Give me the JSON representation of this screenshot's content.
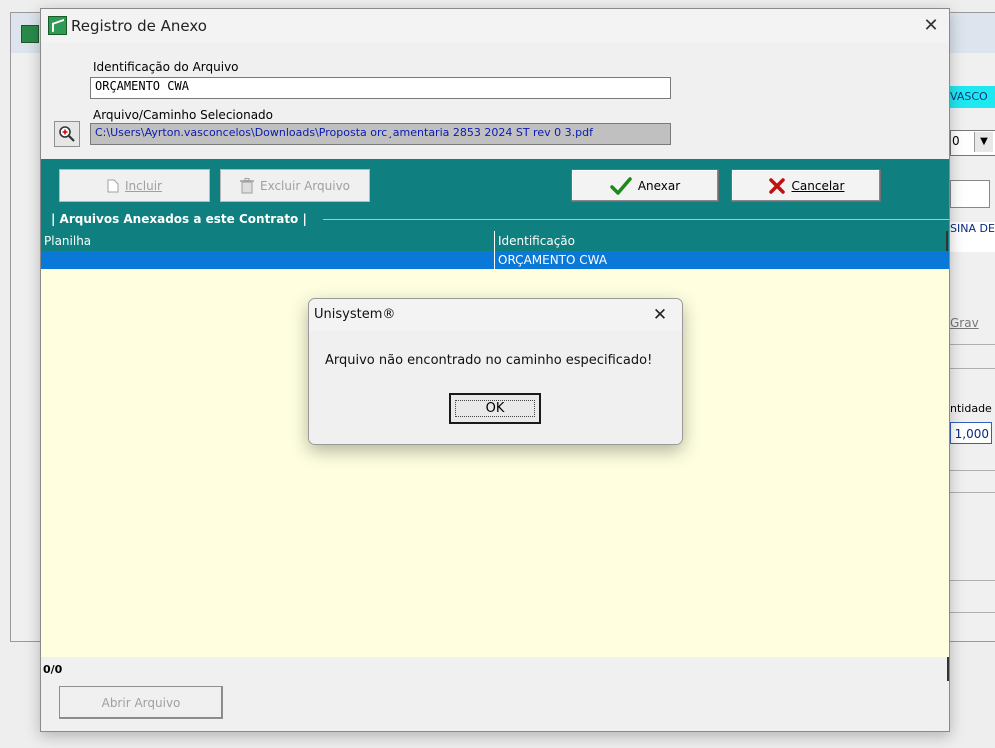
{
  "background_window": {
    "cyan_text": "VASCO",
    "combo_value": "0",
    "combo_arrow": "▼",
    "teal_label": "SINA DE",
    "grav_label": "Grav",
    "qty_header": "ntidade",
    "qty_value": "1,000"
  },
  "dialog": {
    "title": "Registro de Anexo",
    "close_glyph": "✕",
    "identificacao_label": "Identificação do Arquivo",
    "identificacao_value": "ORÇAMENTO CWA",
    "caminho_label": "Arquivo/Caminho Selecionado",
    "caminho_value": "C:\\Users\\Ayrton.vasconcelos\\Downloads\\Proposta orc¸amentaria  2853 2024 ST  rev 0  3.pdf",
    "toolbar": {
      "incluir_label": "Incluir",
      "excluir_label": "Excluir Arquivo",
      "anexar_label": "Anexar",
      "cancelar_label": "Cancelar"
    },
    "group_title": "| Arquivos Anexados a este Contrato |",
    "grid": {
      "columns": [
        "Planilha",
        "Identificação"
      ],
      "rows": [
        {
          "planilha": "",
          "identificacao": "ORÇAMENTO CWA"
        }
      ]
    },
    "record_counter": "0/0",
    "abrir_label": "Abrir Arquivo"
  },
  "message_box": {
    "title": "Unisystem®",
    "close_glyph": "✕",
    "message": "Arquivo não encontrado no caminho especificado!",
    "ok_label": "OK"
  },
  "colors": {
    "teal": "#0f7f7f",
    "grid_background": "#ffffe0",
    "selection": "#0a78d7",
    "path_text": "#0a1ab0"
  }
}
